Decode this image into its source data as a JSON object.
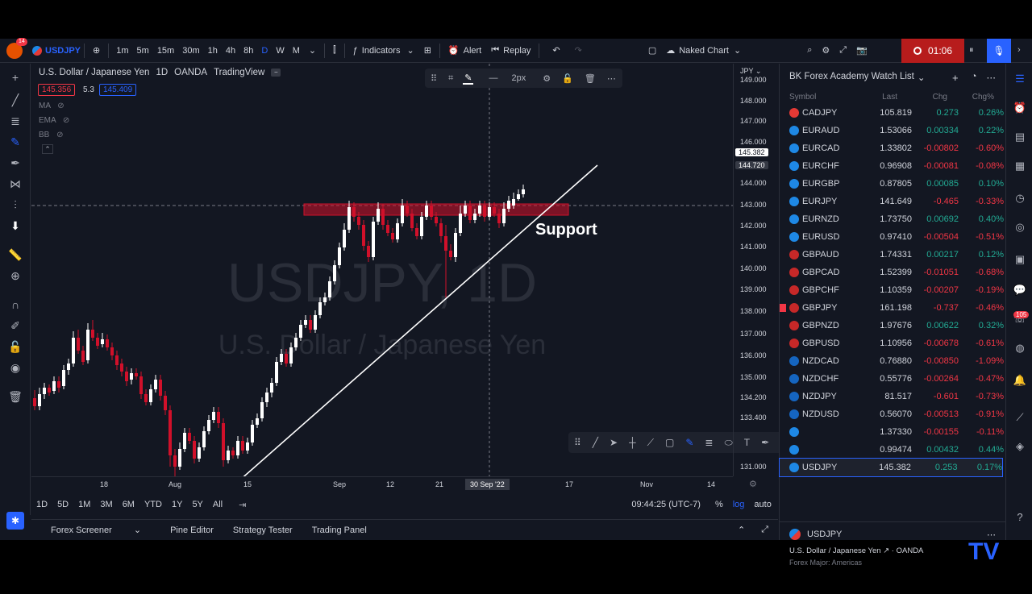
{
  "topbar": {
    "notif_count": "14",
    "symbol": "USDJPY",
    "timeframes": [
      "1m",
      "5m",
      "15m",
      "30m",
      "1h",
      "4h",
      "8h",
      "D",
      "W",
      "M"
    ],
    "active_timeframe": "D",
    "indicators_label": "Indicators",
    "alert_label": "Alert",
    "replay_label": "Replay",
    "layout_label": "Naked Chart",
    "record_time": "01:06"
  },
  "legend": {
    "title": "U.S. Dollar / Japanese Yen",
    "interval": "1D",
    "exchange": "OANDA",
    "source": "TradingView",
    "bid": "145.356",
    "spread": "5.3",
    "ask": "145.409",
    "indicators": [
      "MA",
      "EMA",
      "BB"
    ]
  },
  "drawing_toolbar": {
    "width_label": "2px"
  },
  "watermark": {
    "line1": "USDJPY, 1D",
    "line2": "U.S. Dollar / Japanese Yen"
  },
  "annotation": {
    "support_label": "Support"
  },
  "price_axis": {
    "currency": "JPY",
    "ticks": [
      "149.000",
      "148.000",
      "147.000",
      "146.000",
      "144.000",
      "143.000",
      "142.000",
      "141.000",
      "140.000",
      "139.000",
      "138.000",
      "137.000",
      "136.000",
      "135.000",
      "134.200",
      "133.400",
      "131.000"
    ],
    "current_price": "145.382",
    "zone_price": "144.720"
  },
  "time_axis": {
    "labels": [
      "18",
      "Aug",
      "15",
      "Sep",
      "12",
      "21",
      "17",
      "Nov",
      "14"
    ],
    "crosshair_label": "30 Sep '22"
  },
  "bottom_bar": {
    "ranges": [
      "1D",
      "5D",
      "1M",
      "3M",
      "6M",
      "YTD",
      "1Y",
      "5Y",
      "All"
    ],
    "clock": "09:44:25 (UTC-7)",
    "pct": "%",
    "log": "log",
    "auto": "auto"
  },
  "panels": [
    "Forex Screener",
    "Pine Editor",
    "Strategy Tester",
    "Trading Panel"
  ],
  "watchlist": {
    "title": "BK Forex Academy Watch List",
    "headers": [
      "Symbol",
      "Last",
      "Chg",
      "Chg%"
    ],
    "rows": [
      {
        "s": "CADJPY",
        "l": "105.819",
        "c": "0.273",
        "p": "0.26%",
        "dir": "up"
      },
      {
        "s": "EURAUD",
        "l": "1.53066",
        "c": "0.00334",
        "p": "0.22%",
        "dir": "up"
      },
      {
        "s": "EURCAD",
        "l": "1.33802",
        "c": "-0.00802",
        "p": "-0.60%",
        "dir": "dn"
      },
      {
        "s": "EURCHF",
        "l": "0.96908",
        "c": "-0.00081",
        "p": "-0.08%",
        "dir": "dn"
      },
      {
        "s": "EURGBP",
        "l": "0.87805",
        "c": "0.00085",
        "p": "0.10%",
        "dir": "up"
      },
      {
        "s": "EURJPY",
        "l": "141.649",
        "c": "-0.465",
        "p": "-0.33%",
        "dir": "dn"
      },
      {
        "s": "EURNZD",
        "l": "1.73750",
        "c": "0.00692",
        "p": "0.40%",
        "dir": "up"
      },
      {
        "s": "EURUSD",
        "l": "0.97410",
        "c": "-0.00504",
        "p": "-0.51%",
        "dir": "dn"
      },
      {
        "s": "GBPAUD",
        "l": "1.74331",
        "c": "0.00217",
        "p": "0.12%",
        "dir": "up"
      },
      {
        "s": "GBPCAD",
        "l": "1.52399",
        "c": "-0.01051",
        "p": "-0.68%",
        "dir": "dn"
      },
      {
        "s": "GBPCHF",
        "l": "1.10359",
        "c": "-0.00207",
        "p": "-0.19%",
        "dir": "dn"
      },
      {
        "s": "GBPJPY",
        "l": "161.198",
        "c": "-0.737",
        "p": "-0.46%",
        "dir": "dn"
      },
      {
        "s": "GBPNZD",
        "l": "1.97676",
        "c": "0.00622",
        "p": "0.32%",
        "dir": "up"
      },
      {
        "s": "GBPUSD",
        "l": "1.10956",
        "c": "-0.00678",
        "p": "-0.61%",
        "dir": "dn"
      },
      {
        "s": "NZDCAD",
        "l": "0.76880",
        "c": "-0.00850",
        "p": "-1.09%",
        "dir": "dn"
      },
      {
        "s": "NZDCHF",
        "l": "0.55776",
        "c": "-0.00264",
        "p": "-0.47%",
        "dir": "dn"
      },
      {
        "s": "NZDJPY",
        "l": "81.517",
        "c": "-0.601",
        "p": "-0.73%",
        "dir": "dn"
      },
      {
        "s": "NZDUSD",
        "l": "0.56070",
        "c": "-0.00513",
        "p": "-0.91%",
        "dir": "dn"
      },
      {
        "s": "",
        "l": "1.37330",
        "c": "-0.00155",
        "p": "-0.11%",
        "dir": "dn"
      },
      {
        "s": "",
        "l": "0.99474",
        "c": "0.00432",
        "p": "0.44%",
        "dir": "up"
      },
      {
        "s": "USDJPY",
        "l": "145.382",
        "c": "0.253",
        "p": "0.17%",
        "dir": "up"
      }
    ],
    "details": {
      "symbol": "USDJPY",
      "name": "U.S. Dollar / Japanese Yen",
      "exchange": "OANDA",
      "category": "Forex Major: Americas"
    }
  },
  "colors": {
    "bg": "#131722",
    "accent": "#2962ff",
    "up": "#22ab94",
    "down": "#f23645",
    "candle_up": "#ffffff",
    "candle_down": "#d1102a"
  }
}
